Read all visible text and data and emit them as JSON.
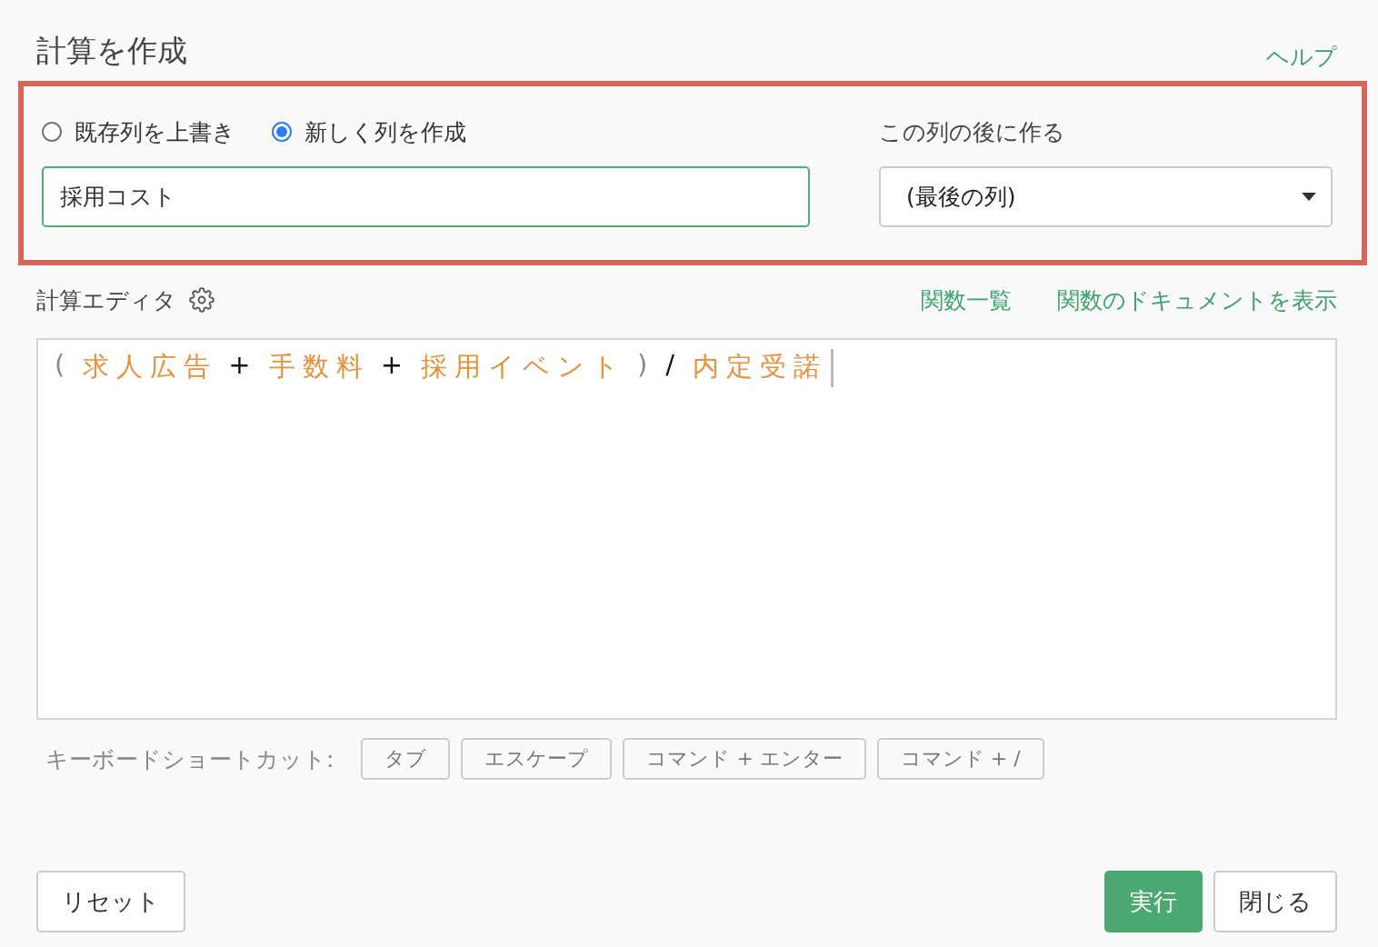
{
  "title": "計算を作成",
  "help_link": "ヘルプ",
  "column_section": {
    "highlighted": true,
    "mode_options": [
      {
        "label": "既存列を上書き",
        "selected": false
      },
      {
        "label": "新しく列を作成",
        "selected": true
      }
    ],
    "column_name": {
      "value": "採用コスト"
    },
    "insert_after": {
      "label": "この列の後に作る",
      "value": "(最後の列)"
    }
  },
  "editor": {
    "label": "計算エディタ",
    "links": [
      "関数一覧",
      "関数のドキュメントを表示"
    ],
    "tokens": [
      {
        "kind": "paren",
        "text": "("
      },
      {
        "kind": "column",
        "text": "求人広告"
      },
      {
        "kind": "operator",
        "text": "+"
      },
      {
        "kind": "column",
        "text": "手数料"
      },
      {
        "kind": "operator",
        "text": "+"
      },
      {
        "kind": "column",
        "text": "採用イベント"
      },
      {
        "kind": "paren",
        "text": ")"
      },
      {
        "kind": "operator",
        "text": "/"
      },
      {
        "kind": "column",
        "text": "内定受諾"
      }
    ]
  },
  "shortcuts": {
    "label": "キーボードショートカット:",
    "keys": [
      "タブ",
      "エスケープ",
      "コマンド + エンター",
      "コマンド + /"
    ]
  },
  "buttons": {
    "reset": "リセット",
    "run": "実行",
    "close": "閉じる"
  }
}
